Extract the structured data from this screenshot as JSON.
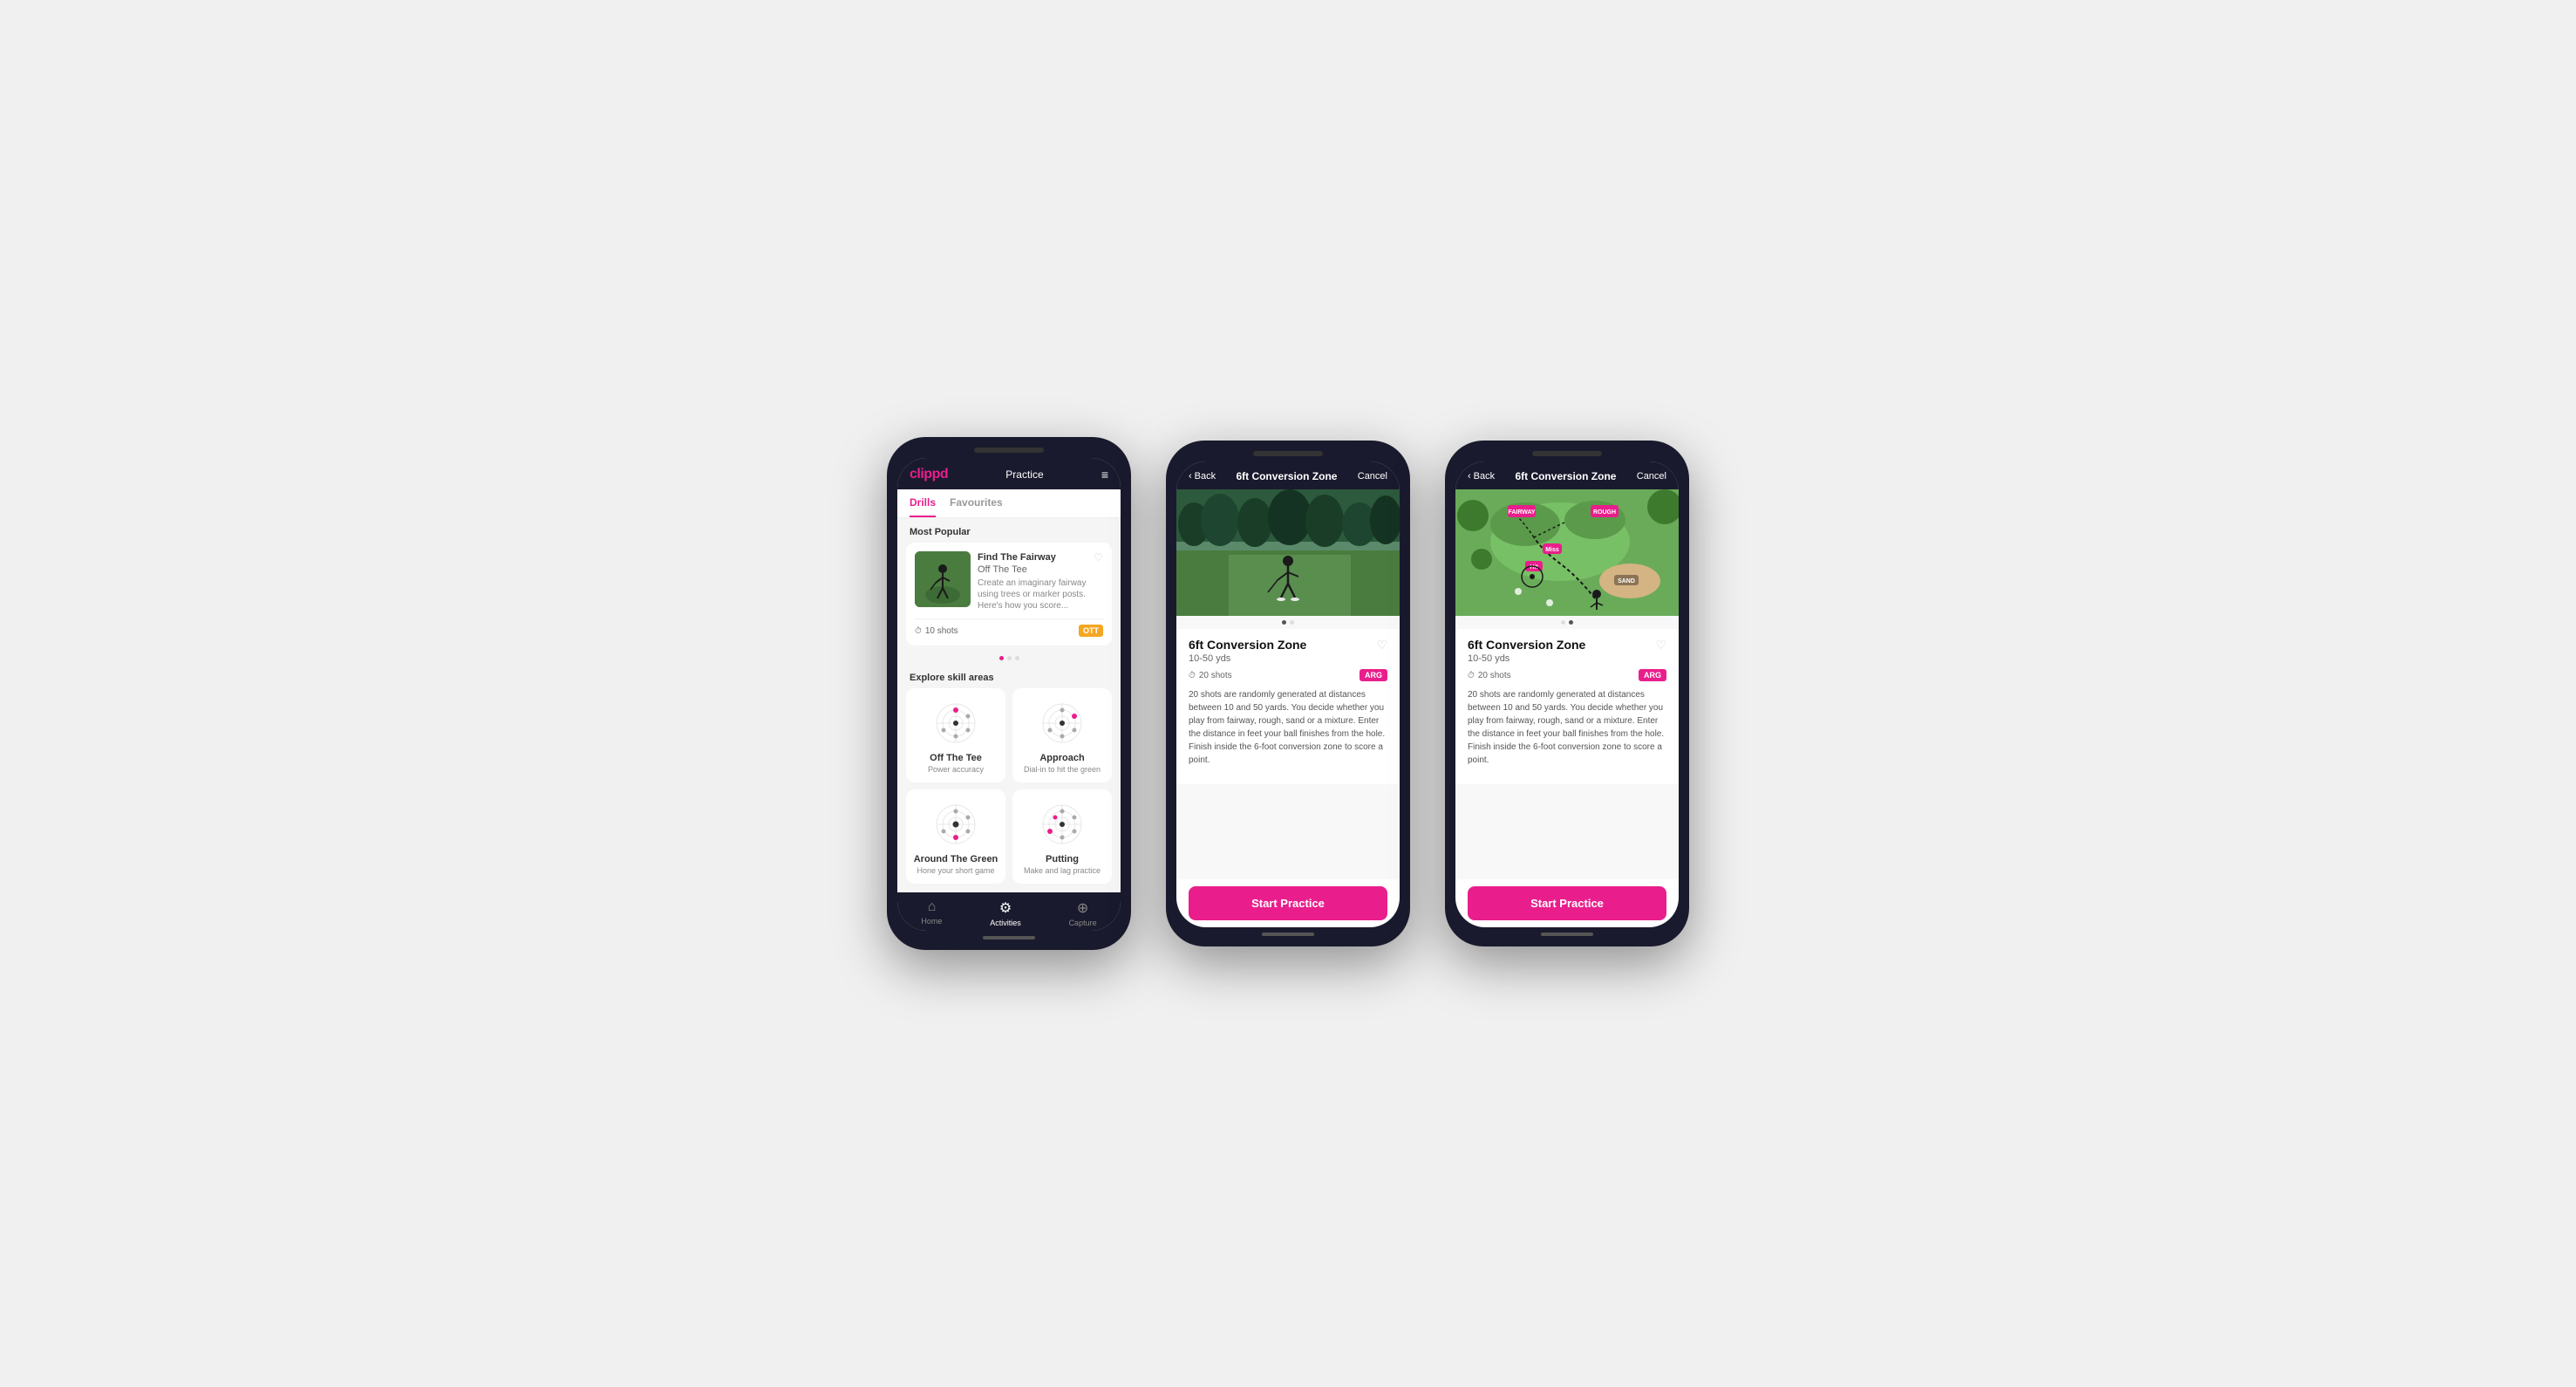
{
  "phone1": {
    "logo": "clippd",
    "header_title": "Practice",
    "menu_icon": "≡",
    "tabs": [
      {
        "label": "Drills",
        "active": true
      },
      {
        "label": "Favourites",
        "active": false
      }
    ],
    "most_popular_label": "Most Popular",
    "featured_drill": {
      "title": "Find The Fairway",
      "subtitle": "Off The Tee",
      "description": "Create an imaginary fairway using trees or marker posts. Here's how you score...",
      "shots": "10 shots",
      "badge": "OTT",
      "fav_icon": "♡"
    },
    "dots": [
      true,
      false,
      false
    ],
    "explore_label": "Explore skill areas",
    "skills": [
      {
        "name": "Off The Tee",
        "desc": "Power accuracy"
      },
      {
        "name": "Approach",
        "desc": "Dial-in to hit the green"
      },
      {
        "name": "Around The Green",
        "desc": "Hone your short game"
      },
      {
        "name": "Putting",
        "desc": "Make and lag practice"
      }
    ],
    "nav": [
      {
        "label": "Home",
        "icon": "⌂",
        "active": false
      },
      {
        "label": "Activities",
        "icon": "⚙",
        "active": true
      },
      {
        "label": "Capture",
        "icon": "⊕",
        "active": false
      }
    ]
  },
  "phone2": {
    "back_label": "Back",
    "header_title": "6ft Conversion Zone",
    "cancel_label": "Cancel",
    "dots": [
      true,
      false
    ],
    "drill": {
      "name": "6ft Conversion Zone",
      "range": "10-50 yds",
      "shots": "20 shots",
      "badge": "ARG",
      "fav_icon": "♡",
      "description": "20 shots are randomly generated at distances between 10 and 50 yards. You decide whether you play from fairway, rough, sand or a mixture. Enter the distance in feet your ball finishes from the hole. Finish inside the 6-foot conversion zone to score a point."
    },
    "start_label": "Start Practice"
  },
  "phone3": {
    "back_label": "Back",
    "header_title": "6ft Conversion Zone",
    "cancel_label": "Cancel",
    "dots": [
      false,
      true
    ],
    "drill": {
      "name": "6ft Conversion Zone",
      "range": "10-50 yds",
      "shots": "20 shots",
      "badge": "ARG",
      "fav_icon": "♡",
      "description": "20 shots are randomly generated at distances between 10 and 50 yards. You decide whether you play from fairway, rough, sand or a mixture. Enter the distance in feet your ball finishes from the hole. Finish inside the 6-foot conversion zone to score a point."
    },
    "start_label": "Start Practice"
  }
}
